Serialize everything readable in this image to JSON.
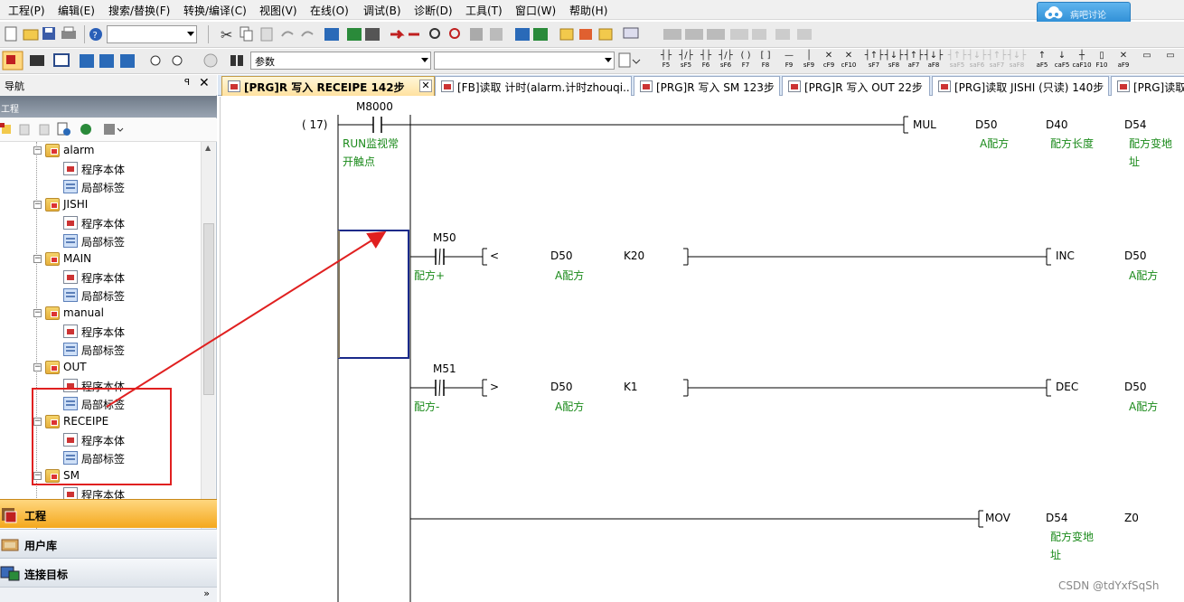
{
  "menubar": {
    "items": [
      "工程(P)",
      "编辑(E)",
      "搜索/替换(F)",
      "转换/编译(C)",
      "视图(V)",
      "在线(O)",
      "调试(B)",
      "诊断(D)",
      "工具(T)",
      "窗口(W)",
      "帮助(H)"
    ],
    "cloud_button": "病吧讨论"
  },
  "toolbar1": {
    "search_combo_value": ""
  },
  "toolbar2": {
    "param_combo": "参数",
    "search_combo": "",
    "fkeys": [
      {
        "glyph": "┤├",
        "label": "F5",
        "disabled": false
      },
      {
        "glyph": "┤/├",
        "label": "sF5",
        "disabled": false
      },
      {
        "glyph": "┤├",
        "label": "F6",
        "disabled": false
      },
      {
        "glyph": "┤/├",
        "label": "sF6",
        "disabled": false
      },
      {
        "glyph": "( )",
        "label": "F7",
        "disabled": false
      },
      {
        "glyph": "[ ]",
        "label": "F8",
        "disabled": false
      },
      {
        "glyph": "—",
        "label": "F9",
        "disabled": false
      },
      {
        "glyph": "│",
        "label": "sF9",
        "disabled": false
      },
      {
        "glyph": "✕",
        "label": "cF9",
        "disabled": false
      },
      {
        "glyph": "✕",
        "label": "cF10",
        "disabled": false
      },
      {
        "glyph": "┤↑├",
        "label": "sF7",
        "disabled": false
      },
      {
        "glyph": "┤↓├",
        "label": "sF8",
        "disabled": false
      },
      {
        "glyph": "┤↑├",
        "label": "aF7",
        "disabled": false
      },
      {
        "glyph": "┤↓├",
        "label": "aF8",
        "disabled": false
      },
      {
        "glyph": "┤↑├",
        "label": "saF5",
        "disabled": true
      },
      {
        "glyph": "┤↓├",
        "label": "saF6",
        "disabled": true
      },
      {
        "glyph": "┤↑├",
        "label": "saF7",
        "disabled": true
      },
      {
        "glyph": "┤↓├",
        "label": "saF8",
        "disabled": true
      },
      {
        "glyph": "↑",
        "label": "aF5",
        "disabled": false
      },
      {
        "glyph": "↓",
        "label": "caF5",
        "disabled": false
      },
      {
        "glyph": "┼",
        "label": "caF10",
        "disabled": false
      },
      {
        "glyph": "▯",
        "label": "F10",
        "disabled": false
      },
      {
        "glyph": "✕",
        "label": "aF9",
        "disabled": false
      },
      {
        "glyph": "▭",
        "label": "",
        "disabled": false
      },
      {
        "glyph": "▭",
        "label": "",
        "disabled": false
      }
    ]
  },
  "nav": {
    "title": "导航",
    "pin": "ꟼ",
    "close": "✕",
    "project_strip": "工程",
    "tree": [
      {
        "type": "folder",
        "label": "alarm"
      },
      {
        "type": "program",
        "label": "程序本体"
      },
      {
        "type": "local",
        "label": "局部标签"
      },
      {
        "type": "folder",
        "label": "JISHI"
      },
      {
        "type": "program",
        "label": "程序本体"
      },
      {
        "type": "local",
        "label": "局部标签"
      },
      {
        "type": "folder",
        "label": "MAIN"
      },
      {
        "type": "program",
        "label": "程序本体"
      },
      {
        "type": "local",
        "label": "局部标签"
      },
      {
        "type": "folder",
        "label": "manual"
      },
      {
        "type": "program",
        "label": "程序本体"
      },
      {
        "type": "local",
        "label": "局部标签"
      },
      {
        "type": "folder",
        "label": "OUT"
      },
      {
        "type": "program",
        "label": "程序本体"
      },
      {
        "type": "local",
        "label": "局部标签"
      },
      {
        "type": "folder",
        "label": "RECEIPE"
      },
      {
        "type": "program",
        "label": "程序本体"
      },
      {
        "type": "local",
        "label": "局部标签"
      },
      {
        "type": "folder",
        "label": "SM"
      },
      {
        "type": "program",
        "label": "程序本体"
      }
    ],
    "sections": {
      "project": "工程",
      "library": "用户库",
      "connection": "连接目标"
    },
    "bottom_arrow": "»"
  },
  "tabs": [
    {
      "label": "[PRG]R 写入 RECEIPE 142步",
      "active": true
    },
    {
      "label": "[FB]读取 计时(alarm.计时zhouqi...",
      "active": false
    },
    {
      "label": "[PRG]R 写入 SM 123步",
      "active": false
    },
    {
      "label": "[PRG]R 写入 OUT 22步",
      "active": false
    },
    {
      "label": "[PRG]读取 JISHI (只读) 140步",
      "active": false
    },
    {
      "label": "[PRG]读取",
      "active": false
    }
  ],
  "ladder": {
    "step": "( 17)",
    "contact_main": {
      "device": "M8000",
      "comment_line1": "RUN监视常",
      "comment_line2": "开触点"
    },
    "rung_mul": {
      "inst": "MUL",
      "op1": "D50",
      "op1c": "A配方",
      "op2": "D40",
      "op2c": "配方长度",
      "op3": "D54",
      "op3c_line1": "配方变地",
      "op3c_line2": "址"
    },
    "rung_inc": {
      "device": "M50",
      "comment": "配方+",
      "cmp": "<",
      "op1": "D50",
      "op1c": "A配方",
      "op2": "K20",
      "inst": "INC",
      "dst": "D50",
      "dstc": "A配方"
    },
    "rung_dec": {
      "device": "M51",
      "comment": "配方-",
      "cmp": ">",
      "op1": "D50",
      "op1c": "A配方",
      "op2": "K1",
      "inst": "DEC",
      "dst": "D50",
      "dstc": "A配方"
    },
    "rung_mov": {
      "inst": "MOV",
      "op1": "D54",
      "op1c_line1": "配方变地",
      "op1c_line2": "址",
      "op2": "Z0"
    }
  },
  "watermark": "CSDN @tdYxfSqSh",
  "colors": {
    "comment_green": "#1a8a1a",
    "annotation_red": "#e02020",
    "cursor_blue": "#1a2a8a",
    "active_tab": "#ffe2a0",
    "nav_project": "#f4a81d"
  }
}
